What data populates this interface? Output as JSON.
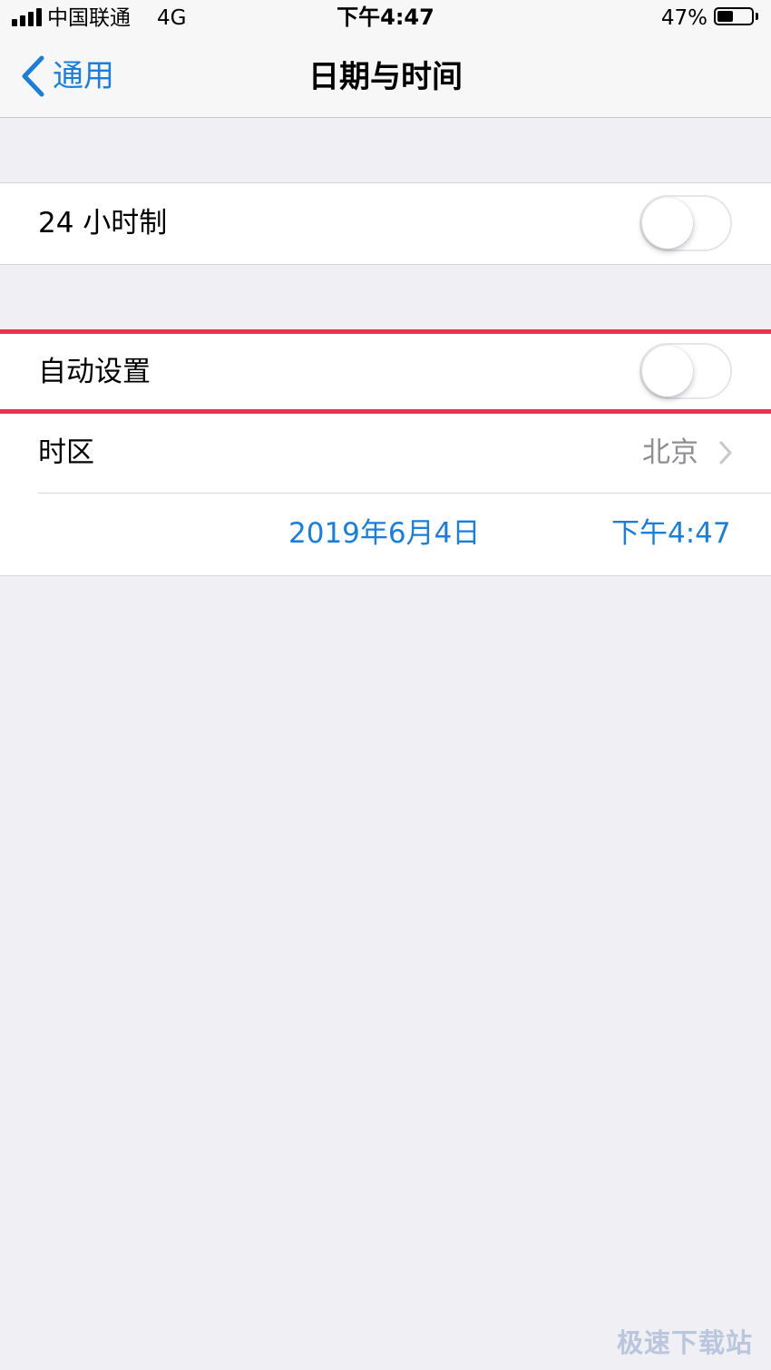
{
  "status_bar": {
    "carrier": "中国联通",
    "network": "4G",
    "time": "下午4:47",
    "battery_percent": "47%",
    "battery_level": 0.47
  },
  "nav": {
    "back_label": "通用",
    "title": "日期与时间"
  },
  "settings": {
    "hour24": {
      "label": "24 小时制",
      "enabled": false
    },
    "auto_set": {
      "label": "自动设置",
      "enabled": false
    },
    "timezone": {
      "label": "时区",
      "value": "北京"
    },
    "date_value": "2019年6月4日",
    "time_value": "下午4:47"
  },
  "watermark": "极速下载站",
  "colors": {
    "accent": "#1a7fdc",
    "highlight": "#e8344e",
    "background": "#efeff4"
  },
  "icons": {
    "back": "chevron-left-icon",
    "disclosure": "chevron-right-icon",
    "signal": "signal-bars-icon",
    "battery": "battery-icon"
  }
}
